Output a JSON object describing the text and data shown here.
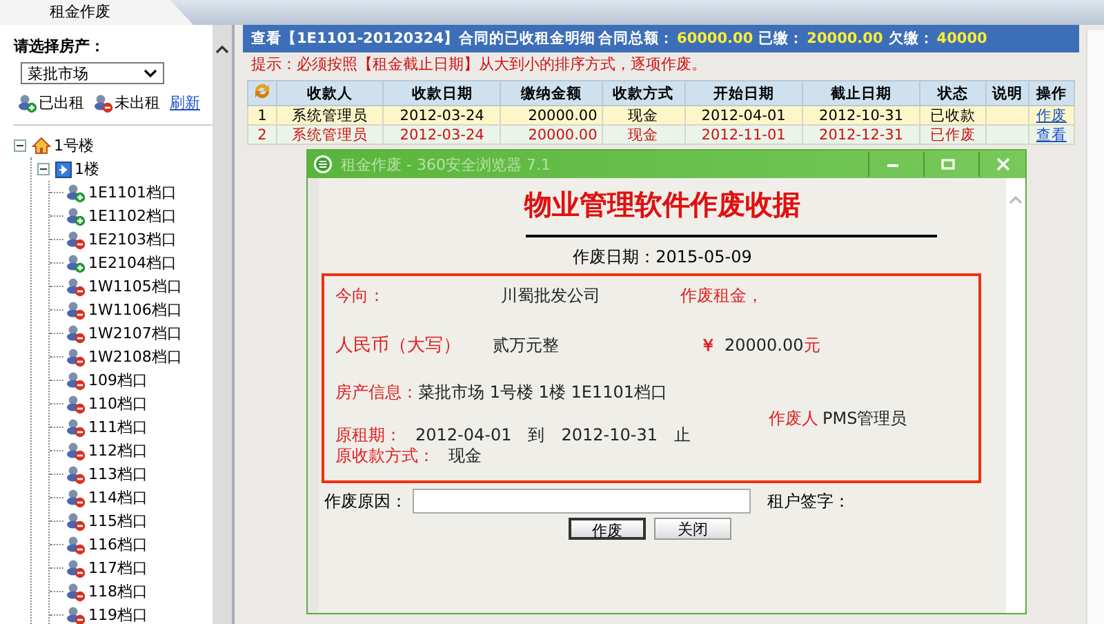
{
  "tab": {
    "label": "租金作废"
  },
  "sidebar": {
    "heading": "请选择房产：",
    "market": "菜批市场",
    "legend": [
      {
        "label": "已出租",
        "rented": true
      },
      {
        "label": "未出租",
        "rented": false
      }
    ],
    "refresh": "刷新",
    "tree": [
      {
        "label": "1号楼",
        "kind": "building",
        "expanded": true,
        "children": [
          {
            "label": "1楼",
            "kind": "floor",
            "expanded": true,
            "children": [
              {
                "label": "1E1101档口",
                "kind": "stall",
                "rented": true
              },
              {
                "label": "1E1102档口",
                "kind": "stall",
                "rented": true
              },
              {
                "label": "1E2103档口",
                "kind": "stall",
                "rented": false
              },
              {
                "label": "1E2104档口",
                "kind": "stall",
                "rented": true
              },
              {
                "label": "1W1105档口",
                "kind": "stall",
                "rented": false
              },
              {
                "label": "1W1106档口",
                "kind": "stall",
                "rented": false
              },
              {
                "label": "1W2107档口",
                "kind": "stall",
                "rented": false
              },
              {
                "label": "1W2108档口",
                "kind": "stall",
                "rented": false
              },
              {
                "label": "109档口",
                "kind": "stall",
                "rented": false
              },
              {
                "label": "110档口",
                "kind": "stall",
                "rented": false
              },
              {
                "label": "111档口",
                "kind": "stall",
                "rented": false
              },
              {
                "label": "112档口",
                "kind": "stall",
                "rented": false
              },
              {
                "label": "113档口",
                "kind": "stall",
                "rented": false
              },
              {
                "label": "114档口",
                "kind": "stall",
                "rented": false
              },
              {
                "label": "115档口",
                "kind": "stall",
                "rented": false
              },
              {
                "label": "116档口",
                "kind": "stall",
                "rented": false
              },
              {
                "label": "117档口",
                "kind": "stall",
                "rented": false
              },
              {
                "label": "118档口",
                "kind": "stall",
                "rented": false
              },
              {
                "label": "119档口",
                "kind": "stall",
                "rented": false
              }
            ]
          }
        ]
      }
    ]
  },
  "header": {
    "title": "查看【1E1101-20120324】合同的已收租金明细",
    "total_label": "合同总额：",
    "total": "60000.00",
    "paid_label": "已缴：",
    "paid": "20000.00",
    "owed_label": "欠缴：",
    "owed": "40000"
  },
  "hint": "提示：必须按照【租金截止日期】从大到小的排序方式，逐项作废。",
  "table": {
    "columns": [
      "收款人",
      "收款日期",
      "缴纳金额",
      "收款方式",
      "开始日期",
      "截止日期",
      "状态",
      "说明",
      "操作"
    ],
    "rows": [
      {
        "index": "1",
        "payee": "系统管理员",
        "date": "2012-03-24",
        "amount": "20000.00",
        "method": "现金",
        "start": "2012-04-01",
        "end": "2012-10-31",
        "status": "已收款",
        "action": "作废",
        "voided": false
      },
      {
        "index": "2",
        "payee": "系统管理员",
        "date": "2012-03-24",
        "amount": "20000.00",
        "method": "现金",
        "start": "2012-11-01",
        "end": "2012-12-31",
        "status": "已作废",
        "action": "查看",
        "voided": true
      }
    ]
  },
  "dialog": {
    "title": "租金作废 - 360安全浏览器 7.1",
    "heading": "物业管理软件作废收据",
    "date": "作废日期：2015-05-09",
    "to_label": "今向：",
    "to": "川蜀批发公司",
    "void_label": "作废租金，",
    "rmb_label": "人民币（大写）",
    "rmb": "贰万元整",
    "yen": "￥",
    "amount": "20000.00",
    "yuan": "元",
    "property_label": "房产信息：",
    "property": "菜批市场 1号楼 1楼 1E1101档口",
    "voider_label": "作废人",
    "voider": "PMS管理员",
    "period_label": "原租期：",
    "period": "2012-04-01　到　2012-10-31　止",
    "method_label": "原收款方式：",
    "method": "现金",
    "reason_label": "作废原因：",
    "signature_label": "租户签字：",
    "buttons": [
      "作废",
      "关闭"
    ]
  }
}
